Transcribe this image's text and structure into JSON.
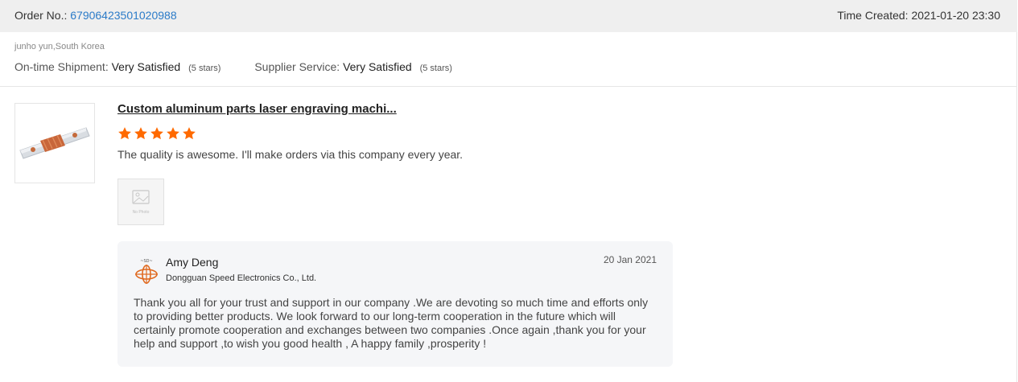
{
  "order": {
    "label": "Order No.:",
    "number": "67906423501020988",
    "time_label": "Time Created:",
    "time_value": "2021-01-20 23:30"
  },
  "buyer": {
    "name_location": "junho yun,South Korea",
    "ratings": [
      {
        "label": "On-time Shipment:",
        "value": "Very Satisfied",
        "stars_text": "(5 stars)"
      },
      {
        "label": "Supplier Service:",
        "value": "Very Satisfied",
        "stars_text": "(5 stars)"
      }
    ]
  },
  "review": {
    "product_title": "Custom aluminum parts laser engraving machi...",
    "rating": 5,
    "star_color": "#ff6a00",
    "text": "The quality is awesome. I'll make orders via this company every year.",
    "photo_placeholder": "No Photo"
  },
  "reply": {
    "name": "Amy Deng",
    "company": "Dongguan Speed Electronics Co., Ltd.",
    "date": "20 Jan 2021",
    "text": "Thank you all for your trust and support in our company .We are devoting so much time and efforts only to providing better products. We look forward to our long-term cooperation in the future which will certainly promote cooperation and exchanges between two companies .Once again ,thank you for your help and support ,to wish you good health , A happy family ,prosperity !"
  },
  "icons": {
    "product": "product-thumbnail-image",
    "no_photo": "image-placeholder-icon",
    "reply_logo": "company-logo-icon",
    "star": "star-icon"
  }
}
